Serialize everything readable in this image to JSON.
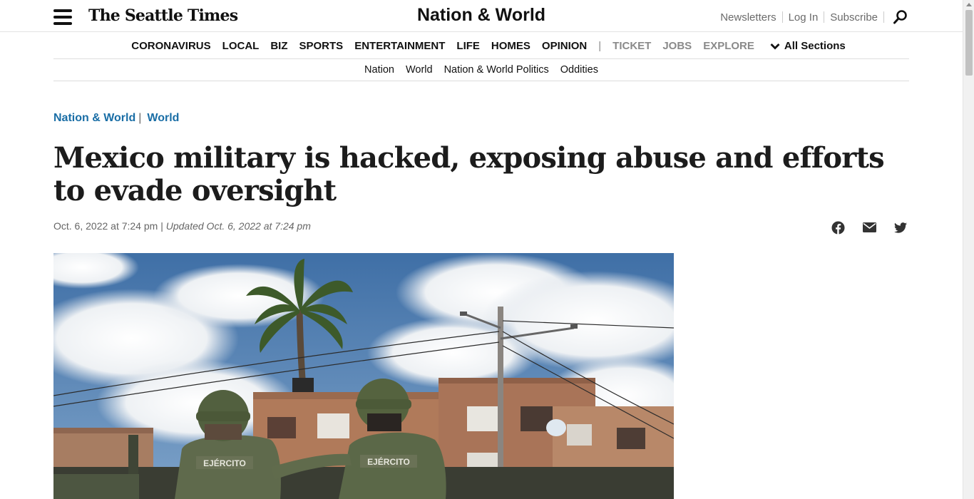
{
  "header": {
    "logo_text": "The Seattle Times",
    "section_title": "Nation & World",
    "utility_links": [
      "Newsletters",
      "Log In",
      "Subscribe"
    ]
  },
  "main_nav": {
    "items": [
      "CORONAVIRUS",
      "LOCAL",
      "BIZ",
      "SPORTS",
      "ENTERTAINMENT",
      "LIFE",
      "HOMES",
      "OPINION"
    ],
    "divider": "|",
    "secondary_items": [
      "TICKET",
      "JOBS",
      "EXPLORE"
    ],
    "all_sections_label": "All Sections"
  },
  "sub_nav": {
    "items": [
      "Nation",
      "World",
      "Nation & World Politics",
      "Oddities"
    ]
  },
  "article": {
    "breadcrumb_primary": "Nation & World",
    "breadcrumb_separator": "|",
    "breadcrumb_secondary": "World",
    "headline": "Mexico military is hacked, exposing abuse and efforts to evade oversight",
    "published": "Oct. 6, 2022 at 7:24 pm",
    "date_separator": "|",
    "updated": "Updated Oct. 6, 2022 at 7:24 pm",
    "photo_text_left": "EJÉRCITO",
    "photo_text_right": "EJÉRCITO"
  },
  "share_icons": [
    "facebook-icon",
    "email-icon",
    "twitter-icon"
  ],
  "colors": {
    "link_blue": "#1a6ea6",
    "nav_gray": "#8a8a8a",
    "sky_blue": "#4f7eb4"
  }
}
